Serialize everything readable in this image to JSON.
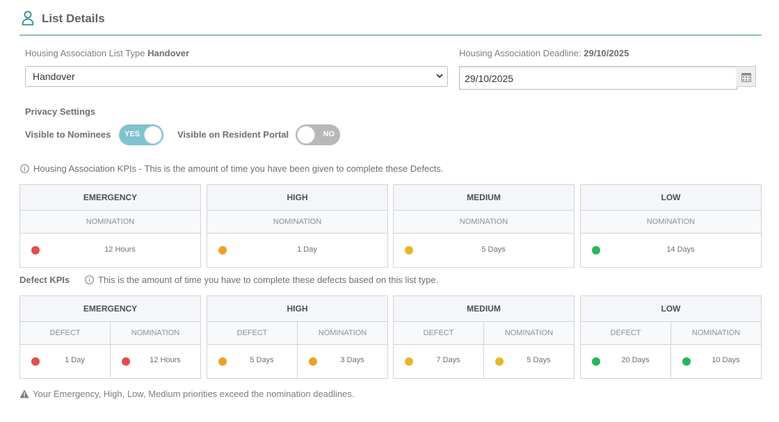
{
  "header": {
    "title": "List Details",
    "icon": "user-icon"
  },
  "list_type": {
    "label": "Housing Association List Type",
    "value": "Handover",
    "selected": "Handover"
  },
  "deadline": {
    "label": "Housing Association Deadline:",
    "value": "29/10/2025",
    "input_value": "29/10/2025",
    "icon": "calendar-icon"
  },
  "privacy": {
    "title": "Privacy Settings",
    "nominees_label": "Visible to Nominees",
    "nominees_toggle": "YES",
    "nominees_on": true,
    "portal_label": "Visible on Resident Portal",
    "portal_toggle": "NO",
    "portal_on": false
  },
  "ha_kpis": {
    "info": "Housing Association KPIs - This is the amount of time you have been given to complete these Defects.",
    "cards": [
      {
        "priority": "EMERGENCY",
        "sub": "NOMINATION",
        "value": "12 Hours",
        "color": "#e84b4b"
      },
      {
        "priority": "HIGH",
        "sub": "NOMINATION",
        "value": "1 Day",
        "color": "#f0a020"
      },
      {
        "priority": "MEDIUM",
        "sub": "NOMINATION",
        "value": "5 Days",
        "color": "#e8b820"
      },
      {
        "priority": "LOW",
        "sub": "NOMINATION",
        "value": "14 Days",
        "color": "#22b85a"
      }
    ]
  },
  "defect_kpis": {
    "heading": "Defect KPIs",
    "info": "This is the amount of time you have to complete these defects based on this list type.",
    "defect_label": "DEFECT",
    "nomination_label": "NOMINATION",
    "cards": [
      {
        "priority": "EMERGENCY",
        "defect": "1 Day",
        "nomination": "12 Hours",
        "color": "#e84b4b"
      },
      {
        "priority": "HIGH",
        "defect": "5 Days",
        "nomination": "3 Days",
        "color": "#f0a020"
      },
      {
        "priority": "MEDIUM",
        "defect": "7 Days",
        "nomination": "5 Days",
        "color": "#e8b820"
      },
      {
        "priority": "LOW",
        "defect": "20 Days",
        "nomination": "10 Days",
        "color": "#22b85a"
      }
    ]
  },
  "warning": {
    "text": "Your Emergency, High, Low, Medium priorities exceed the nomination deadlines.",
    "icon": "warning-icon"
  }
}
